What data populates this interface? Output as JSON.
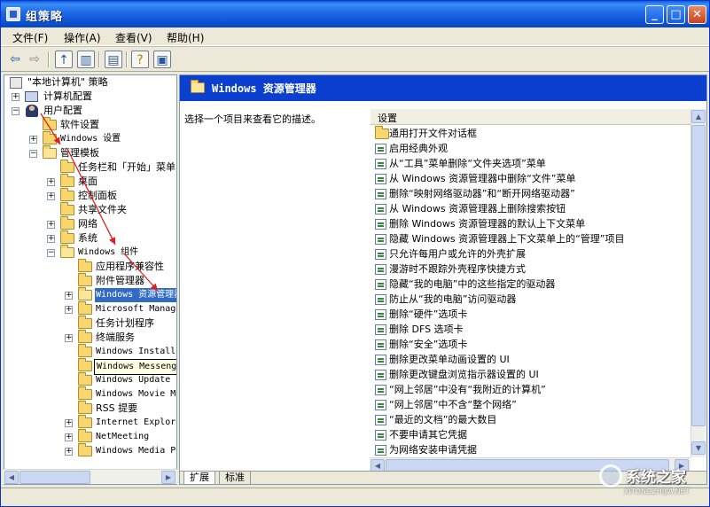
{
  "window": {
    "title": "组策略",
    "buttons": {
      "minimize": "_",
      "maximize": "□",
      "close": "✕"
    }
  },
  "menu": [
    "文件(F)",
    "操作(A)",
    "查看(V)",
    "帮助(H)"
  ],
  "toolbar": {
    "back_icon": "back-arrow-icon",
    "forward_icon": "forward-arrow-icon",
    "up_icon": "up-folder-icon",
    "show_tree_icon": "show-hide-tree-icon",
    "export_icon": "export-list-icon",
    "help_icon": "help-icon",
    "properties_icon": "properties-icon"
  },
  "tree": {
    "root": "\"本地计算机\" 策略",
    "computer_config": "计算机配置",
    "user_config": "用户配置",
    "software_settings": "软件设置",
    "windows_settings": "Windows 设置",
    "admin_templates": "管理模板",
    "taskbar_start": "任务栏和「开始」菜单",
    "desktop": "桌面",
    "control_panel": "控制面板",
    "shared_folders": "共享文件夹",
    "network": "网络",
    "system": "系统",
    "windows_components": "Windows 组件",
    "app_compat": "应用程序兼容性",
    "attachment_manager": "附件管理器",
    "windows_explorer": "Windows 资源管理器",
    "mmc": "Microsoft Management Console",
    "task_scheduler": "任务计划程序",
    "terminal_services": "终端服务",
    "windows_installer": "Windows Installer",
    "windows_messenger": "Windows Messenger",
    "windows_update": "Windows Update",
    "movie_maker": "Windows Movie Maker",
    "rss": "RSS 提要",
    "ie": "Internet Explorer",
    "netmeeting": "NetMeeting",
    "media_player": "Windows Media Player"
  },
  "right_pane": {
    "header": "Windows 资源管理器",
    "description": "选择一个项目来查看它的描述。",
    "column_header": "设置",
    "settings": [
      "通用打开文件对话框",
      "启用经典外观",
      "从“工具”菜单删除“文件夹选项”菜单",
      "从 Windows 资源管理器中删除“文件”菜单",
      "删除“映射网络驱动器”和“断开网络驱动器”",
      "从 Windows 资源管理器上删除搜索按钮",
      "删除 Windows 资源管理器的默认上下文菜单",
      "隐藏 Windows 资源管理器上下文菜单上的“管理”项目",
      "只允许每用户或允许的外壳扩展",
      "漫游时不跟踪外壳程序快捷方式",
      "隐藏“我的电脑”中的这些指定的驱动器",
      "防止从“我的电脑”访问驱动器",
      "删除“硬件”选项卡",
      "删除 DFS 选项卡",
      "删除“安全”选项卡",
      "删除更改菜单动画设置的 UI",
      "删除更改键盘浏览指示器设置的 UI",
      "“网上邻居”中没有“我附近的计算机”",
      "“网上邻居”中不含“整个网络”",
      "“最近的文档”的最大数目",
      "不要申请其它凭据",
      "为网络安装申请凭据"
    ],
    "tabs": [
      "扩展",
      "标准"
    ]
  },
  "watermark": {
    "text": "系统之家",
    "url": "XITONGZHIJIA.NET"
  },
  "colors": {
    "title_bar": "#1d68e6",
    "selection": "#316ac5",
    "header_blue": "#0a3fd0",
    "annotation_arrow": "#e02020"
  }
}
